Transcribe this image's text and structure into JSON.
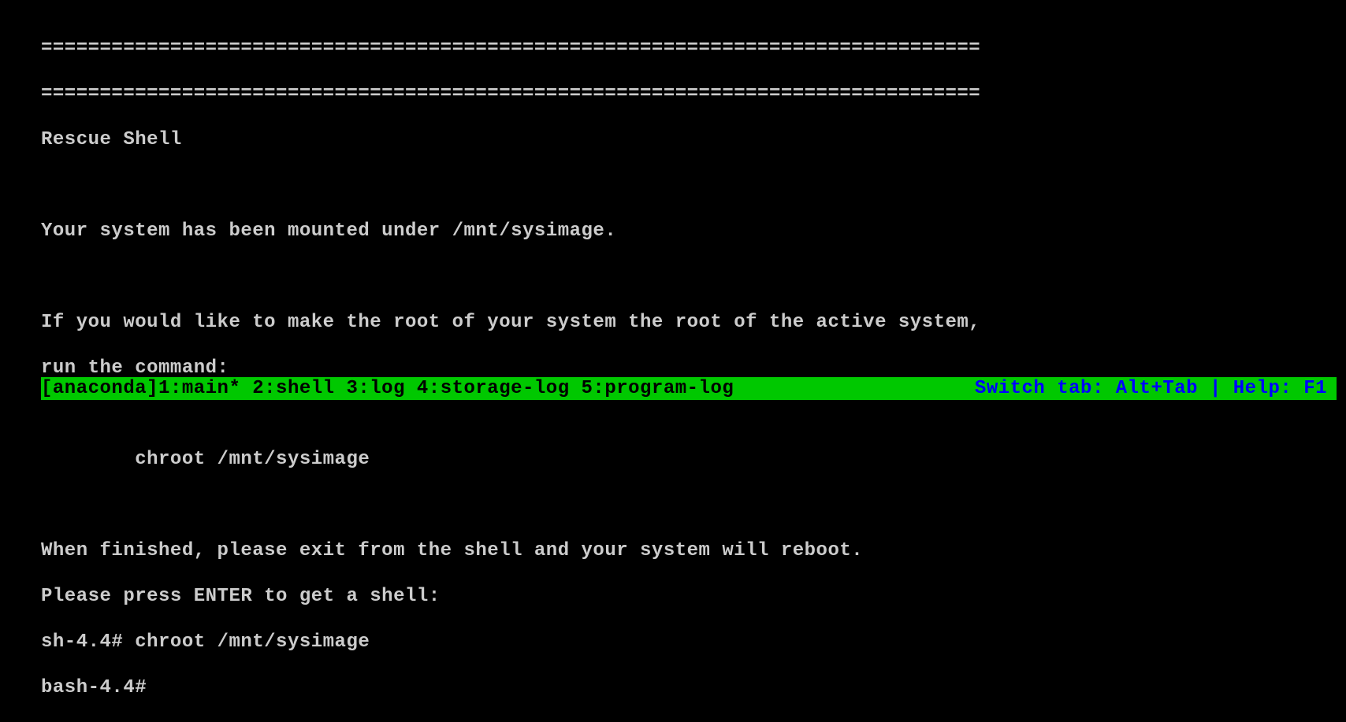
{
  "terminal": {
    "divider1": "================================================================================",
    "divider2": "================================================================================",
    "title": "Rescue Shell",
    "blank1": "",
    "mounted_msg": "Your system has been mounted under /mnt/sysimage.",
    "blank2": "",
    "root_msg1": "If you would like to make the root of your system the root of the active system,",
    "root_msg2": "run the command:",
    "blank3": "",
    "chroot_cmd": "        chroot /mnt/sysimage",
    "blank4": "",
    "finished_msg": "When finished, please exit from the shell and your system will reboot.",
    "press_enter": "Please press ENTER to get a shell:",
    "sh_prompt": "sh-4.4# chroot /mnt/sysimage",
    "bash_prompt": "bash-4.4#"
  },
  "statusbar": {
    "prefix": "[anaconda]",
    "tabs": "1:main* 2:shell  3:log  4:storage-log  5:program-log",
    "help": "Switch tab: Alt+Tab | Help: F1"
  }
}
